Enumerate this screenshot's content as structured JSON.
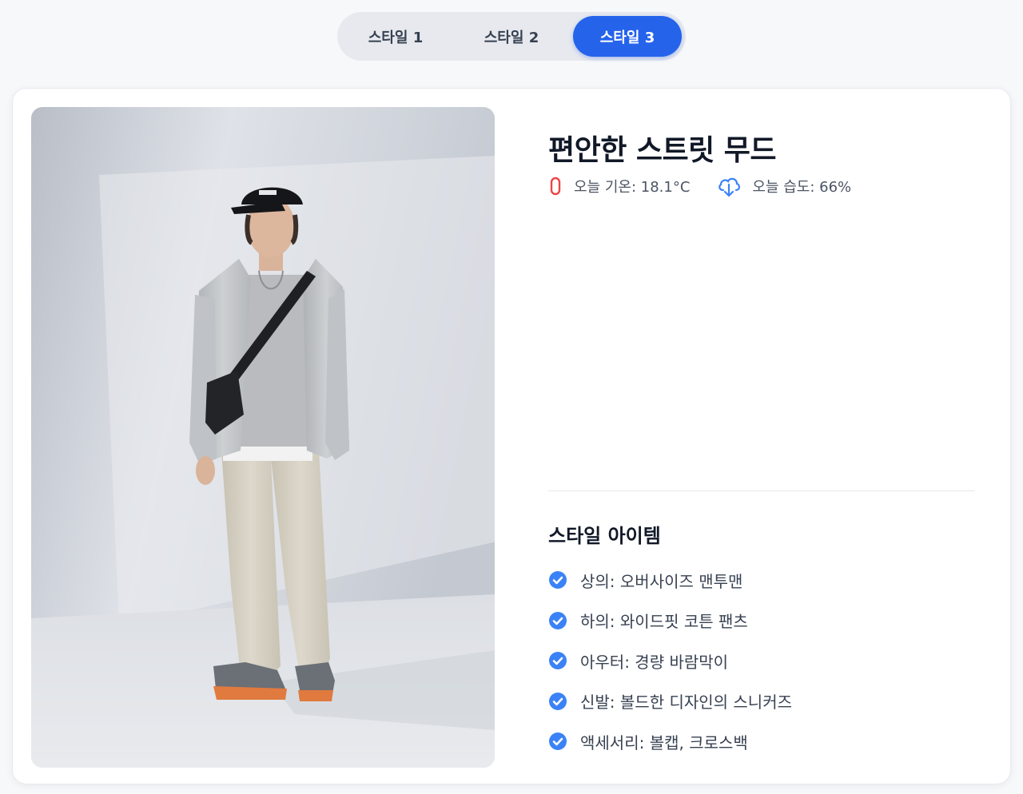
{
  "tabs": [
    {
      "label": "스타일 1",
      "active": false
    },
    {
      "label": "스타일 2",
      "active": false
    },
    {
      "label": "스타일 3",
      "active": true
    }
  ],
  "card": {
    "title": "편안한 스트릿 무드",
    "weather": {
      "temperature_text": "오늘 기온: 18.1°C",
      "temperature_icon": "thermometer-icon",
      "humidity_text": "오늘 습도: 66%",
      "humidity_icon": "cloud-download-icon"
    },
    "items_title": "스타일 아이템",
    "items": [
      "상의: 오버사이즈 맨투맨",
      "하의: 와이드핏 코튼 팬츠",
      "아우터: 경량 바람막이",
      "신발: 볼드한 디자인의 스니커즈",
      "액세서리: 볼캡, 크로스백"
    ],
    "item_icon": "check-circle-icon"
  },
  "colors": {
    "accent": "#2563eb",
    "check": "#3b82f6",
    "thermometer": "#ef4444",
    "humidity": "#3b82f6",
    "background": "#f7f8fa"
  }
}
